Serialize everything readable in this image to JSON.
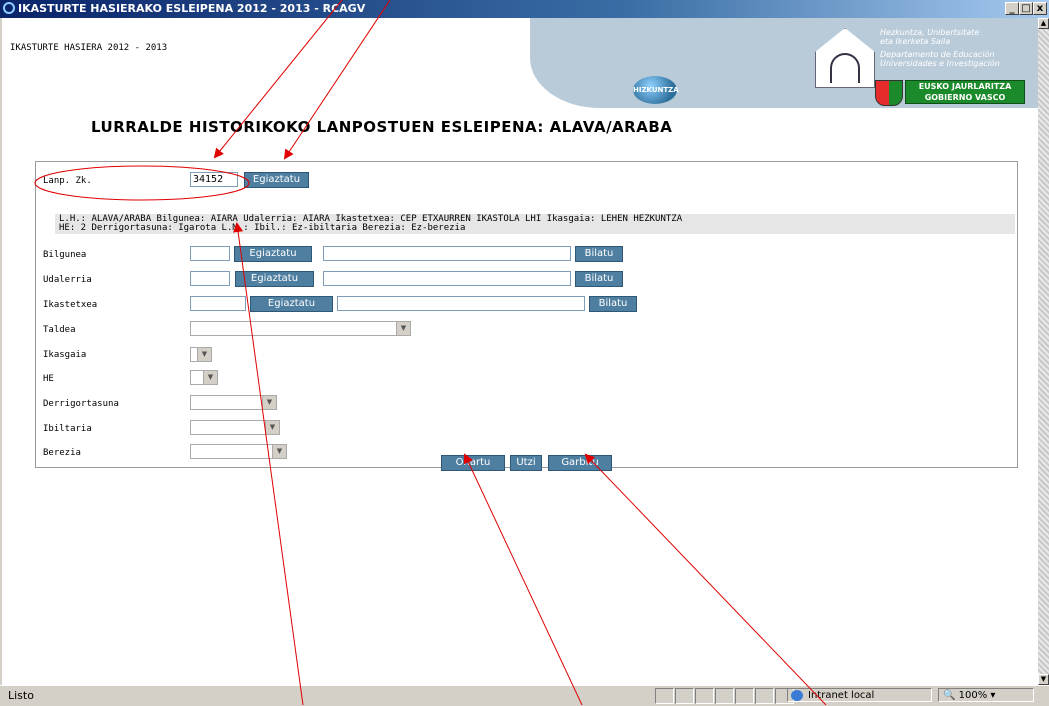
{
  "window": {
    "title": "IKASTURTE HASIERAKO ESLEIPENA 2012 - 2013 - RCAGV",
    "controls": [
      "_",
      "□",
      "x"
    ]
  },
  "page": {
    "header": "IKASTURTE HASIERA 2012 - 2013"
  },
  "banner": {
    "hizkuntza": "HIZKUNTZA",
    "dept_lines": [
      "Hezkuntza, Unibertsitate",
      "eta Ikerketa Saila",
      "Departamento de Educación",
      "Universidades e Investigación"
    ],
    "gov_lines": [
      "EUSKO JAURLARITZA",
      "GOBIERNO VASCO"
    ]
  },
  "title": "LURRALDE HISTORIKOKO LANPOSTUEN ESLEIPENA: ALAVA/ARABA",
  "form": {
    "lanp_label": "Lanp. Zk.",
    "lanp_value": "34152",
    "egiaztatu": "Egiaztatu",
    "bilatu": "Bilatu",
    "info_line1": "L.H.: ALAVA/ARABA  Bilgunea: AIARA  Udalerria: AIARA  Ikastetxea: CEP ETXAURREN IKASTOLA LHI  Ikasgaia:  LEHEN HEZKUNTZA",
    "info_line2": "HE: 2  Derrigortasuna:  Igarota  L.M.:   Ibil.: Ez-ibiltaria  Berezia: Ez-berezia",
    "fields": {
      "bilgunea": "Bilgunea",
      "udalerria": "Udalerria",
      "ikastetxea": "Ikastetxea",
      "taldea": "Taldea",
      "ikasgaia": "Ikasgaia",
      "he": "HE",
      "derrigortasuna": "Derrigortasuna",
      "ibiltaria": "Ibiltaria",
      "berezia": "Berezia"
    },
    "actions": {
      "onartu": "Onartu",
      "utzi": "Utzi",
      "garbitu": "Garbitu"
    }
  },
  "statusbar": {
    "status": "Listo",
    "zone": "Intranet local",
    "zoom": "100%"
  },
  "colors": {
    "button": "#4f7fa0",
    "banner": "#b9cbd9",
    "annotation": "#e00000"
  }
}
